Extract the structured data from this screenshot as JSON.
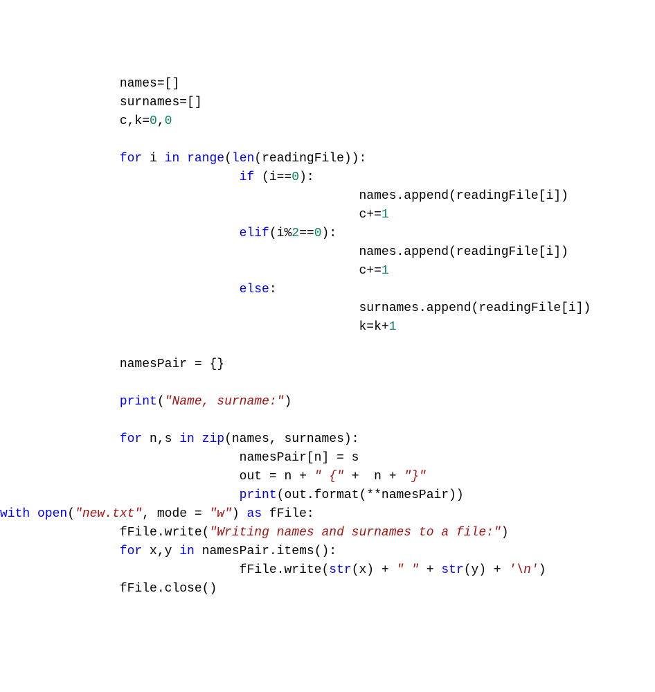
{
  "code": {
    "lines": [
      {
        "indent": 4,
        "segs": [
          {
            "t": "names=[]",
            "c": "txt"
          }
        ]
      },
      {
        "indent": 4,
        "segs": [
          {
            "t": "surnames=[]",
            "c": "txt"
          }
        ]
      },
      {
        "indent": 4,
        "segs": [
          {
            "t": "c,k=",
            "c": "txt"
          },
          {
            "t": "0",
            "c": "num"
          },
          {
            "t": ",",
            "c": "txt"
          },
          {
            "t": "0",
            "c": "num"
          }
        ]
      },
      {
        "indent": 0,
        "segs": []
      },
      {
        "indent": 4,
        "segs": [
          {
            "t": "for",
            "c": "kw"
          },
          {
            "t": " i ",
            "c": "txt"
          },
          {
            "t": "in",
            "c": "kw"
          },
          {
            "t": " ",
            "c": "txt"
          },
          {
            "t": "range",
            "c": "builtin"
          },
          {
            "t": "(",
            "c": "txt"
          },
          {
            "t": "len",
            "c": "builtin"
          },
          {
            "t": "(readingFile)):",
            "c": "txt"
          }
        ]
      },
      {
        "indent": 8,
        "segs": [
          {
            "t": "if",
            "c": "kw"
          },
          {
            "t": " (i==",
            "c": "txt"
          },
          {
            "t": "0",
            "c": "num"
          },
          {
            "t": "):",
            "c": "txt"
          }
        ]
      },
      {
        "indent": 12,
        "segs": [
          {
            "t": "names.append(readingFile[i])",
            "c": "txt"
          }
        ]
      },
      {
        "indent": 12,
        "segs": [
          {
            "t": "c+=",
            "c": "txt"
          },
          {
            "t": "1",
            "c": "num"
          }
        ]
      },
      {
        "indent": 8,
        "segs": [
          {
            "t": "elif",
            "c": "kw"
          },
          {
            "t": "(i%",
            "c": "txt"
          },
          {
            "t": "2",
            "c": "num"
          },
          {
            "t": "==",
            "c": "txt"
          },
          {
            "t": "0",
            "c": "num"
          },
          {
            "t": "):",
            "c": "txt"
          }
        ]
      },
      {
        "indent": 12,
        "segs": [
          {
            "t": "names.append(readingFile[i])",
            "c": "txt"
          }
        ]
      },
      {
        "indent": 12,
        "segs": [
          {
            "t": "c+=",
            "c": "txt"
          },
          {
            "t": "1",
            "c": "num"
          }
        ]
      },
      {
        "indent": 8,
        "segs": [
          {
            "t": "else",
            "c": "kw"
          },
          {
            "t": ":",
            "c": "txt"
          }
        ]
      },
      {
        "indent": 12,
        "segs": [
          {
            "t": "surnames.append(readingFile[i])",
            "c": "txt"
          }
        ]
      },
      {
        "indent": 12,
        "segs": [
          {
            "t": "k=k+",
            "c": "txt"
          },
          {
            "t": "1",
            "c": "num"
          }
        ]
      },
      {
        "indent": 0,
        "segs": []
      },
      {
        "indent": 4,
        "segs": [
          {
            "t": "namesPair = {}",
            "c": "txt"
          }
        ]
      },
      {
        "indent": 0,
        "segs": []
      },
      {
        "indent": 4,
        "segs": [
          {
            "t": "print",
            "c": "builtin"
          },
          {
            "t": "(",
            "c": "txt"
          },
          {
            "t": "\"Name, surname:\"",
            "c": "str"
          },
          {
            "t": ")",
            "c": "txt"
          }
        ]
      },
      {
        "indent": 0,
        "segs": []
      },
      {
        "indent": 4,
        "segs": [
          {
            "t": "for",
            "c": "kw"
          },
          {
            "t": " n,s ",
            "c": "txt"
          },
          {
            "t": "in",
            "c": "kw"
          },
          {
            "t": " ",
            "c": "txt"
          },
          {
            "t": "zip",
            "c": "builtin"
          },
          {
            "t": "(names, surnames):",
            "c": "txt"
          }
        ]
      },
      {
        "indent": 8,
        "segs": [
          {
            "t": "namesPair[n] = s",
            "c": "txt"
          }
        ]
      },
      {
        "indent": 8,
        "segs": [
          {
            "t": "out = n + ",
            "c": "txt"
          },
          {
            "t": "\" {\"",
            "c": "str"
          },
          {
            "t": " +  n + ",
            "c": "txt"
          },
          {
            "t": "\"}\"",
            "c": "str"
          }
        ]
      },
      {
        "indent": 8,
        "segs": [
          {
            "t": "print",
            "c": "builtin"
          },
          {
            "t": "(out.format(**namesPair))",
            "c": "txt"
          }
        ]
      },
      {
        "indent": 0,
        "segs": [
          {
            "t": "with",
            "c": "kw"
          },
          {
            "t": " ",
            "c": "txt"
          },
          {
            "t": "open",
            "c": "builtin"
          },
          {
            "t": "(",
            "c": "txt"
          },
          {
            "t": "\"new.txt\"",
            "c": "str"
          },
          {
            "t": ", mode = ",
            "c": "txt"
          },
          {
            "t": "\"w\"",
            "c": "str"
          },
          {
            "t": ") ",
            "c": "txt"
          },
          {
            "t": "as",
            "c": "kw"
          },
          {
            "t": " fFile:",
            "c": "txt"
          }
        ]
      },
      {
        "indent": 4,
        "segs": [
          {
            "t": "fFile.write(",
            "c": "txt"
          },
          {
            "t": "\"Writing names and surnames to a file:\"",
            "c": "str"
          },
          {
            "t": ")",
            "c": "txt"
          }
        ]
      },
      {
        "indent": 4,
        "segs": [
          {
            "t": "for",
            "c": "kw"
          },
          {
            "t": " x,y ",
            "c": "txt"
          },
          {
            "t": "in",
            "c": "kw"
          },
          {
            "t": " namesPair.items():",
            "c": "txt"
          }
        ]
      },
      {
        "indent": 8,
        "segs": [
          {
            "t": "fFile.write(",
            "c": "txt"
          },
          {
            "t": "str",
            "c": "builtin"
          },
          {
            "t": "(x) + ",
            "c": "txt"
          },
          {
            "t": "\" \"",
            "c": "str"
          },
          {
            "t": " + ",
            "c": "txt"
          },
          {
            "t": "str",
            "c": "builtin"
          },
          {
            "t": "(y) + ",
            "c": "txt"
          },
          {
            "t": "'\\n'",
            "c": "str"
          },
          {
            "t": ")",
            "c": "txt"
          }
        ]
      },
      {
        "indent": 4,
        "segs": [
          {
            "t": "fFile.close()",
            "c": "txt"
          }
        ]
      }
    ]
  }
}
